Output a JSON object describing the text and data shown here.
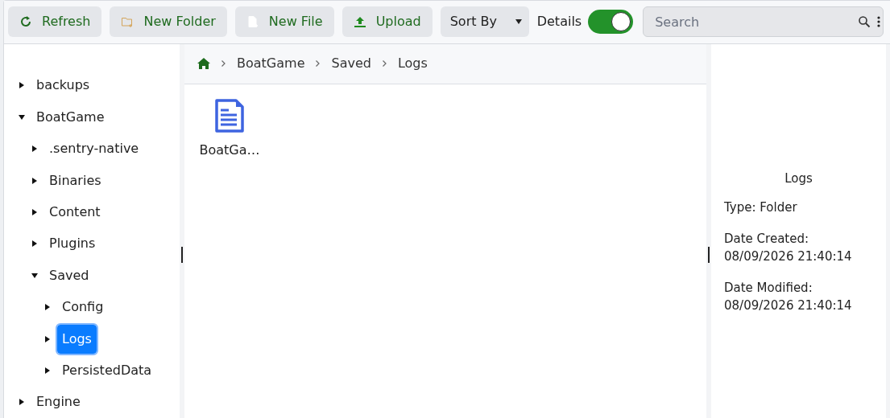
{
  "toolbar": {
    "buttons": [
      {
        "label": "Refresh",
        "kind": "refresh"
      },
      {
        "label": "New Folder",
        "kind": "new-folder"
      },
      {
        "label": "New File",
        "kind": "new-file"
      },
      {
        "label": "Upload",
        "kind": "upload"
      }
    ],
    "sort": {
      "label": "Sort By"
    },
    "details_toggle": {
      "label": "Details",
      "on": true
    },
    "search": {
      "placeholder": "Search"
    }
  },
  "tree": [
    {
      "label": "backups",
      "expanded": false,
      "selected": false
    },
    {
      "label": "BoatGame",
      "expanded": true,
      "selected": false,
      "children": [
        {
          "label": ".sentry-native",
          "expanded": false,
          "selected": false
        },
        {
          "label": "Binaries",
          "expanded": false,
          "selected": false
        },
        {
          "label": "Content",
          "expanded": false,
          "selected": false
        },
        {
          "label": "Plugins",
          "expanded": false,
          "selected": false
        },
        {
          "label": "Saved",
          "expanded": true,
          "selected": false,
          "children": [
            {
              "label": "Config",
              "expanded": false,
              "selected": false
            },
            {
              "label": "Logs",
              "expanded": false,
              "selected": true
            },
            {
              "label": "PersistedData",
              "expanded": false,
              "selected": false
            }
          ]
        }
      ]
    },
    {
      "label": "Engine",
      "expanded": false,
      "selected": false
    }
  ],
  "breadcrumb": [
    "BoatGame",
    "Saved",
    "Logs"
  ],
  "files": [
    {
      "name": "BoatGa…",
      "kind": "document"
    }
  ],
  "details": {
    "title": "Logs",
    "fields": [
      {
        "label": "Type: Folder"
      },
      {
        "label": "Date Created:",
        "value": "08/09/2026 21:40:14"
      },
      {
        "label": "Date Modified:",
        "value": "08/09/2026 21:40:14"
      }
    ]
  }
}
